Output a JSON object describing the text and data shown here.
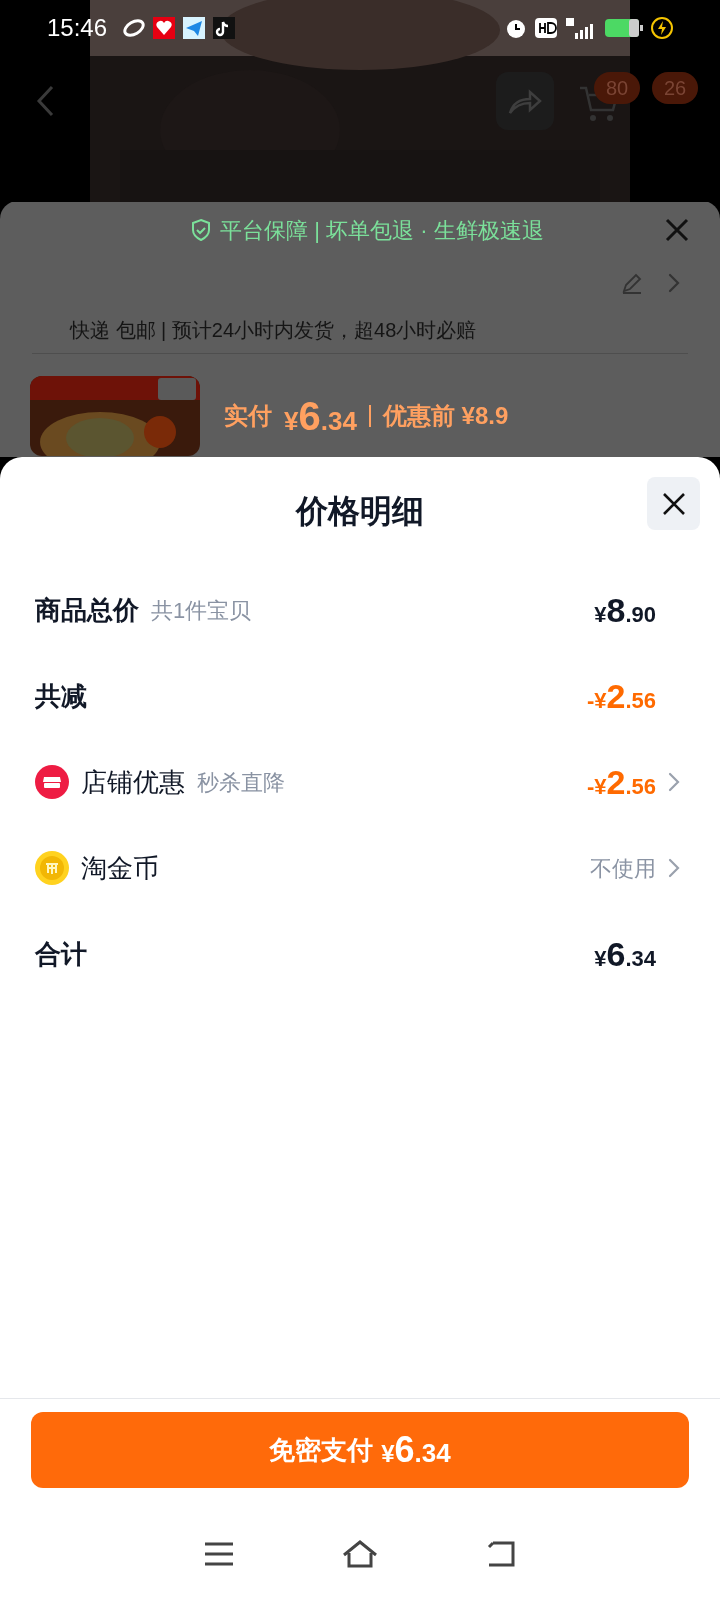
{
  "status_bar": {
    "time": "15:46"
  },
  "header": {
    "badges": [
      "80",
      "26"
    ]
  },
  "background_sheet": {
    "guarantee": "平台保障 | 坏单包退 · 生鲜极速退",
    "shipping": "快递 包邮 | 预计24小时内发货，超48小时必赔",
    "paid_label": "实付",
    "paid_price": {
      "prefix": "¥",
      "integer": "6",
      "decimal": ".34"
    },
    "original_price": "优惠前 ¥8.9"
  },
  "price_sheet": {
    "title": "价格明细",
    "rows": [
      {
        "kind": "summary",
        "label": "商品总价",
        "note": "共1件宝贝",
        "amount": {
          "prefix": "¥",
          "integer": "8",
          "decimal": ".90"
        },
        "discount": false,
        "link": false
      },
      {
        "kind": "summary",
        "label": "共减",
        "amount": {
          "prefix": "-¥",
          "integer": "2",
          "decimal": ".56"
        },
        "discount": true,
        "link": false
      },
      {
        "kind": "shop",
        "label": "店铺优惠",
        "note": "秒杀直降",
        "amount": {
          "prefix": "-¥",
          "integer": "2",
          "decimal": ".56"
        },
        "discount": true,
        "link": true
      },
      {
        "kind": "coin",
        "label": "淘金币",
        "value": "不使用",
        "discount": false,
        "link": true
      },
      {
        "kind": "summary",
        "label": "合计",
        "amount": {
          "prefix": "¥",
          "integer": "6",
          "decimal": ".34"
        },
        "discount": false,
        "link": false
      }
    ]
  },
  "pay_button": {
    "label": "免密支付",
    "amount": {
      "prefix": "¥",
      "integer": "6",
      "decimal": ".34"
    }
  }
}
